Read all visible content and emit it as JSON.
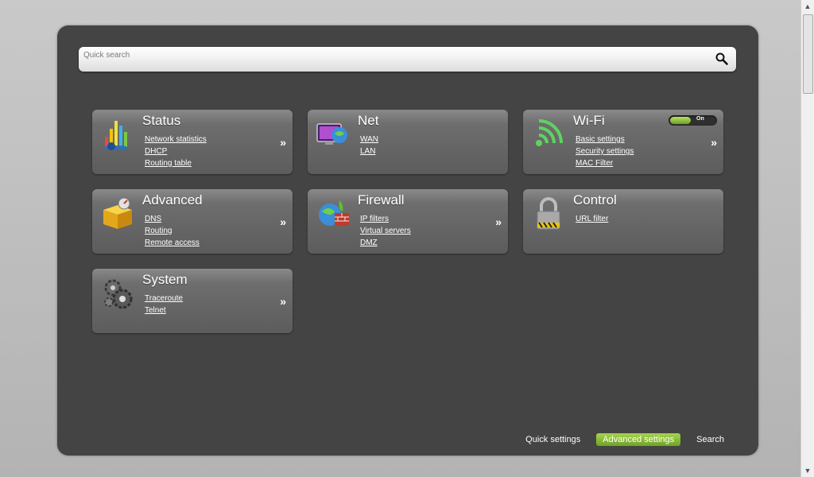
{
  "search": {
    "placeholder": "Quick search",
    "value": ""
  },
  "cards": [
    {
      "title": "Status",
      "icon": "status-chart-icon",
      "links": [
        "Network statistics",
        "DHCP",
        "Routing table"
      ],
      "more": "»"
    },
    {
      "title": "Net",
      "icon": "net-monitor-globe-icon",
      "links": [
        "WAN",
        "LAN"
      ],
      "more": ""
    },
    {
      "title": "Wi-Fi",
      "icon": "wifi-signal-icon",
      "links": [
        "Basic settings",
        "Security settings",
        "MAC Filter"
      ],
      "more": "»",
      "toggle": {
        "label": "On",
        "state": "on"
      }
    },
    {
      "title": "Advanced",
      "icon": "advanced-box-icon",
      "links": [
        "DNS",
        "Routing",
        "Remote access"
      ],
      "more": "»"
    },
    {
      "title": "Firewall",
      "icon": "firewall-globe-icon",
      "links": [
        "IP filters",
        "Virtual servers",
        "DMZ"
      ],
      "more": "»"
    },
    {
      "title": "Control",
      "icon": "padlock-icon",
      "links": [
        "URL filter"
      ],
      "more": ""
    },
    {
      "title": "System",
      "icon": "gears-icon",
      "links": [
        "Traceroute",
        "Telnet"
      ],
      "more": "»"
    }
  ],
  "bottom_nav": [
    {
      "label": "Quick settings",
      "active": false
    },
    {
      "label": "Advanced settings",
      "active": true
    },
    {
      "label": "Search",
      "active": false
    }
  ],
  "colors": {
    "panel": "#444444",
    "accent": "#8cc63f"
  }
}
